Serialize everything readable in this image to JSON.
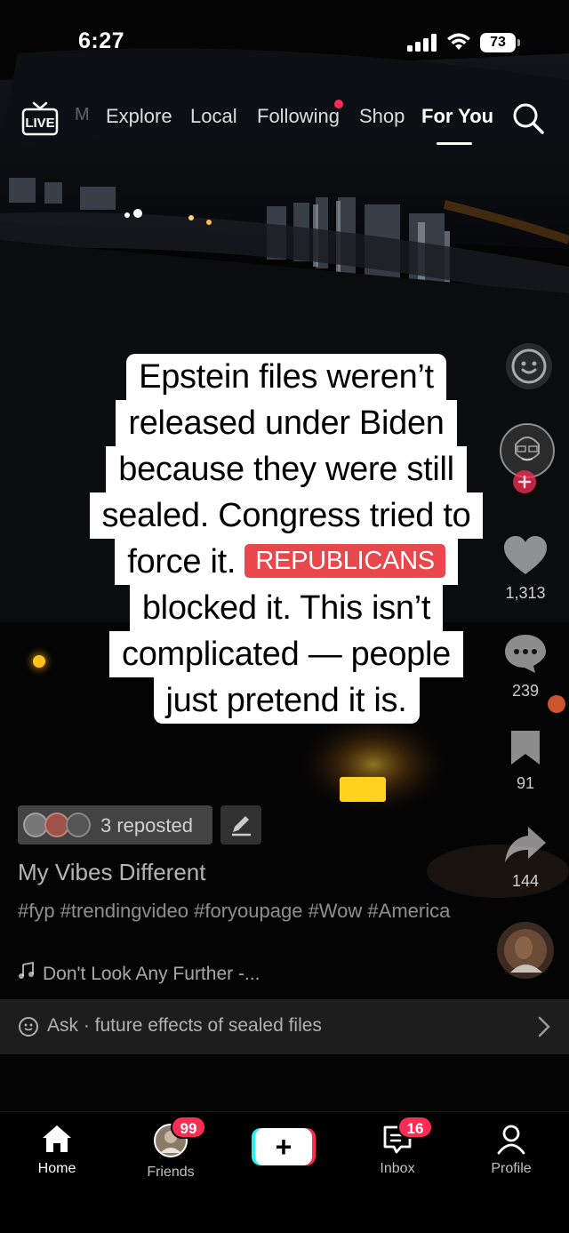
{
  "status_bar": {
    "time": "6:27",
    "battery": "73"
  },
  "top_nav": {
    "live_label": "LIVE",
    "divider": "M",
    "tabs": [
      {
        "label": "Explore"
      },
      {
        "label": "Local"
      },
      {
        "label": "Following",
        "has_dot": true
      },
      {
        "label": "Shop"
      },
      {
        "label": "For You",
        "active": true
      }
    ]
  },
  "caption": {
    "lines": [
      "Epstein files weren’t",
      "released under Biden",
      "because they were still",
      "sealed. Congress tried to",
      "force it.",
      "blocked it. This isn’t",
      "complicated — people",
      "just pretend it is."
    ],
    "highlight": "REPUBLICANS"
  },
  "actions": {
    "likes": "1,313",
    "comments": "239",
    "saves": "91",
    "shares": "144"
  },
  "post": {
    "reposted": "3 reposted",
    "author": "My Vibes Different",
    "description": "#fyp #trendingvideo #foryoupage #Wow #America",
    "sound": "Don't Look Any Further -..."
  },
  "ask": {
    "text": "Ask · future effects of sealed files"
  },
  "bottom_nav": {
    "home": "Home",
    "friends": "Friends",
    "friends_badge": "99",
    "create": "+",
    "inbox": "Inbox",
    "inbox_badge": "16",
    "profile": "Profile"
  },
  "colors": {
    "accent": "#fe2c55",
    "highlight_red": "#e8474b",
    "cyan": "#25f4ee"
  }
}
